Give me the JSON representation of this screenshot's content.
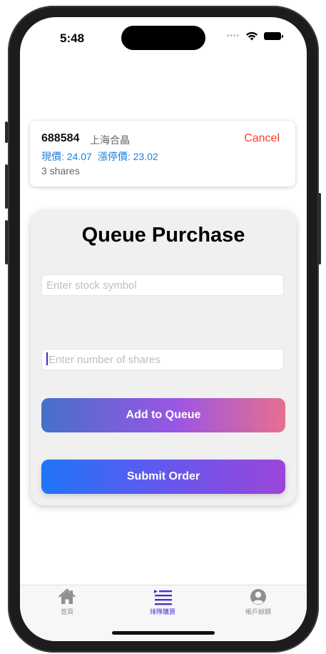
{
  "status_bar": {
    "time": "5:48"
  },
  "queued_item": {
    "symbol": "688584",
    "name": "上海合晶",
    "cancel_label": "Cancel",
    "current_price": "現價: 24.07",
    "limit_up_price": "漲停價: 23.02",
    "shares": "3 shares"
  },
  "form": {
    "title": "Queue Purchase",
    "stock_placeholder": "Enter stock symbol",
    "stock_value": "",
    "shares_placeholder": "Enter number of shares",
    "shares_value": "",
    "add_label": "Add to Queue",
    "submit_label": "Submit Order"
  },
  "tabs": [
    {
      "label": "首頁",
      "icon": "house-icon",
      "active": false
    },
    {
      "label": "排隊購買",
      "icon": "list-icon",
      "active": true
    },
    {
      "label": "帳戶餘額",
      "icon": "person-circle-icon",
      "active": false
    }
  ],
  "colors": {
    "active_tab": "#4a2fd0",
    "inactive_tab": "#8e8e93",
    "cancel": "#ff3b30",
    "price": "#1a7fe0"
  }
}
